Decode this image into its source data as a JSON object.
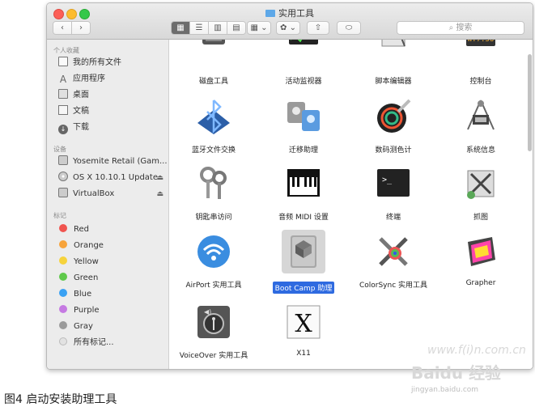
{
  "window": {
    "title": "实用工具",
    "search_placeholder": "搜索",
    "back": "‹",
    "forward": "›",
    "view_buttons": [
      "▦",
      "☰",
      "▥",
      "▤"
    ],
    "arrange": "▦ ⌄",
    "action": "✿ ⌄",
    "share": "⇧",
    "tag": "⬭"
  },
  "sidebar": {
    "favorites_header": "个人收藏",
    "favorites": [
      {
        "label": "我的所有文件",
        "icon": "all-files-icon"
      },
      {
        "label": "应用程序",
        "icon": "applications-icon"
      },
      {
        "label": "桌面",
        "icon": "desktop-icon"
      },
      {
        "label": "文稿",
        "icon": "documents-icon"
      },
      {
        "label": "下载",
        "icon": "downloads-icon"
      }
    ],
    "devices_header": "设备",
    "devices": [
      {
        "label": "Yosemite Retail (Gam...",
        "icon": "disk-icon",
        "eject": false
      },
      {
        "label": "OS X 10.10.1 Update",
        "icon": "cd-icon",
        "eject": true
      },
      {
        "label": "VirtualBox",
        "icon": "disk-icon",
        "eject": true
      }
    ],
    "eject_glyph": "⏏",
    "tags_header": "标记",
    "tags": [
      {
        "label": "Red",
        "color": "#f0544f"
      },
      {
        "label": "Orange",
        "color": "#f7a33a"
      },
      {
        "label": "Yellow",
        "color": "#f6d33c"
      },
      {
        "label": "Green",
        "color": "#5fc94b"
      },
      {
        "label": "Blue",
        "color": "#3aa1f3"
      },
      {
        "label": "Purple",
        "color": "#c57ae2"
      },
      {
        "label": "Gray",
        "color": "#9b9b9b"
      },
      {
        "label": "所有标记...",
        "color": "#e2e2e2"
      }
    ]
  },
  "files": [
    {
      "label": "磁盘工具",
      "icon": "disk-utility-icon"
    },
    {
      "label": "活动监视器",
      "icon": "activity-monitor-icon"
    },
    {
      "label": "脚本编辑器",
      "icon": "script-editor-icon"
    },
    {
      "label": "控制台",
      "icon": "console-icon",
      "display": "WY7:36"
    },
    {
      "label": "蓝牙文件交换",
      "icon": "bluetooth-icon"
    },
    {
      "label": "迁移助理",
      "icon": "migration-assistant-icon"
    },
    {
      "label": "数码测色计",
      "icon": "color-meter-icon"
    },
    {
      "label": "系统信息",
      "icon": "system-information-icon"
    },
    {
      "label": "钥匙串访问",
      "icon": "keychain-icon"
    },
    {
      "label": "音频 MIDI 设置",
      "icon": "audio-midi-icon"
    },
    {
      "label": "终端",
      "icon": "terminal-icon",
      "prompt": ">_"
    },
    {
      "label": "抓图",
      "icon": "grab-icon"
    },
    {
      "label": "AirPort 实用工具",
      "icon": "airport-icon"
    },
    {
      "label": "Boot Camp 助理",
      "icon": "boot-camp-icon",
      "selected": true
    },
    {
      "label": "ColorSync 实用工具",
      "icon": "colorsync-icon"
    },
    {
      "label": "Grapher",
      "icon": "grapher-icon"
    },
    {
      "label": "VoiceOver 实用工具",
      "icon": "voiceover-icon"
    },
    {
      "label": "X11",
      "icon": "x11-icon",
      "glyph": "X"
    }
  ],
  "caption": "图4 启动安装助理工具",
  "watermark": {
    "line1": "Baidu 经验",
    "line2": "jingyan.baidu.com",
    "line0": "www.f(i)n.com.cn"
  }
}
